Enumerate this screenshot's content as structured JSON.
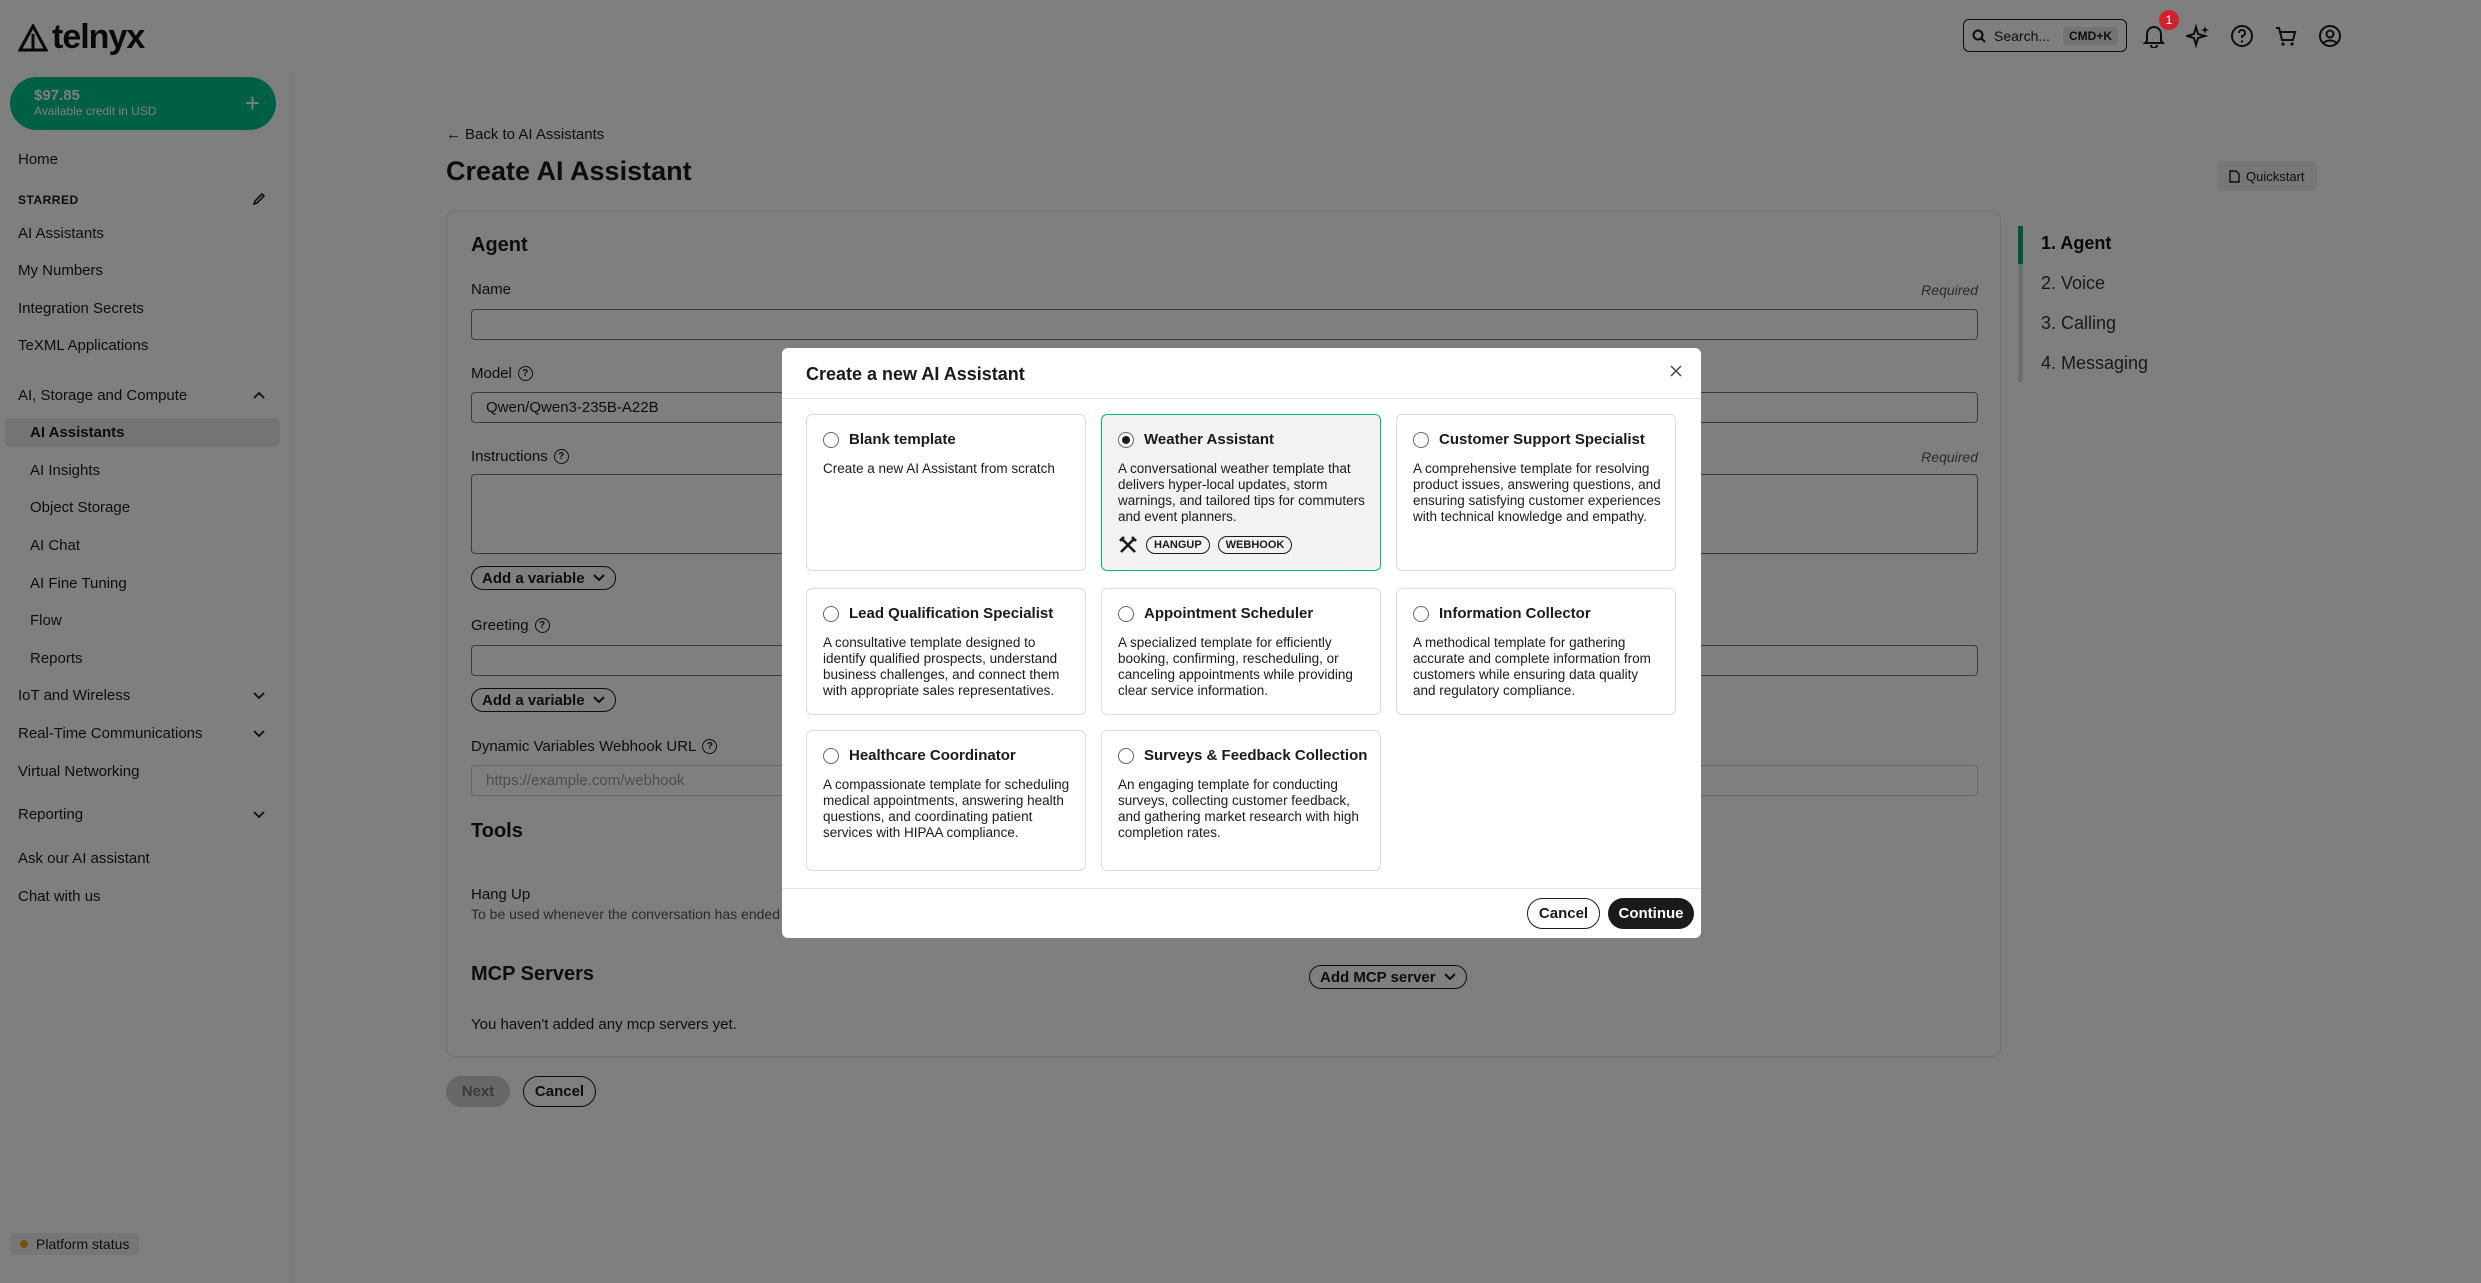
{
  "brand": {
    "name": "telnyx"
  },
  "topbar": {
    "search_label": "Search...",
    "search_shortcut": "CMD+K",
    "notification_count": "1",
    "icons": [
      "search-icon",
      "bell-icon",
      "sparkle-icon",
      "help-icon",
      "cart-icon",
      "account-icon"
    ]
  },
  "sidebar": {
    "credit_amount": "$97.85",
    "credit_label": "Available credit in USD",
    "home": "Home",
    "starred_label": "STARRED",
    "starred": [
      "AI Assistants",
      "My Numbers",
      "Integration Secrets",
      "TeXML Applications"
    ],
    "group_ai": "AI, Storage and Compute",
    "ai_items": [
      "AI Assistants",
      "AI Insights",
      "Object Storage",
      "AI Chat",
      "AI Fine Tuning",
      "Flow",
      "Reports"
    ],
    "iot": "IoT and Wireless",
    "rtc": "Real-Time Communications",
    "vnet": "Virtual Networking",
    "reporting": "Reporting",
    "ask_ai": "Ask our AI assistant",
    "chat": "Chat with us",
    "platform_status": "Platform status"
  },
  "page": {
    "back": "Back to AI Assistants",
    "title": "Create AI Assistant",
    "quickstart": "Quickstart",
    "agent_title": "Agent",
    "name_label": "Name",
    "required": "Required",
    "model_label": "Model",
    "model_value": "Qwen/Qwen3-235B-A22B",
    "instructions_label": "Instructions",
    "add_variable": "Add a variable",
    "greeting_label": "Greeting",
    "webhook_label": "Dynamic Variables Webhook URL",
    "webhook_placeholder": "https://example.com/webhook",
    "tools_title": "Tools",
    "hangup_title": "Hang Up",
    "hangup_desc": "To be used whenever the conversation has ended",
    "mcp_title": "MCP Servers",
    "add_mcp": "Add MCP server",
    "mcp_empty": "You haven't added any mcp servers yet.",
    "next": "Next",
    "cancel": "Cancel"
  },
  "steps": [
    "1. Agent",
    "2. Voice",
    "3. Calling",
    "4. Messaging"
  ],
  "modal": {
    "title": "Create a new AI Assistant",
    "cancel": "Cancel",
    "continue": "Continue",
    "selected": "Weather Assistant",
    "templates": [
      {
        "name": "Blank template",
        "desc": "Create a new AI Assistant from scratch"
      },
      {
        "name": "Weather Assistant",
        "desc": "A conversational weather template that delivers hyper-local updates, storm warnings, and tailored tips for commuters and event planners.",
        "tags": [
          "HANGUP",
          "WEBHOOK"
        ]
      },
      {
        "name": "Customer Support Specialist",
        "desc": "A comprehensive template for resolving product issues, answering questions, and ensuring satisfying customer experiences with technical knowledge and empathy."
      },
      {
        "name": "Lead Qualification Specialist",
        "desc": "A consultative template designed to identify qualified prospects, understand business challenges, and connect them with appropriate sales representatives."
      },
      {
        "name": "Appointment Scheduler",
        "desc": "A specialized template for efficiently booking, confirming, rescheduling, or canceling appointments while providing clear service information."
      },
      {
        "name": "Information Collector",
        "desc": "A methodical template for gathering accurate and complete information from customers while ensuring data quality and regulatory compliance."
      },
      {
        "name": "Healthcare Coordinator",
        "desc": "A compassionate template for scheduling medical appointments, answering health questions, and coordinating patient services with HIPAA compliance."
      },
      {
        "name": "Surveys & Feedback Collection",
        "desc": "An engaging template for conducting surveys, collecting customer feedback, and gathering market research with high completion rates."
      }
    ]
  },
  "colors": {
    "brand_green": "#00c08b",
    "accent_green": "#00a878",
    "badge_red": "#d2202f",
    "overlay": "rgba(0,0,0,0.5)"
  }
}
